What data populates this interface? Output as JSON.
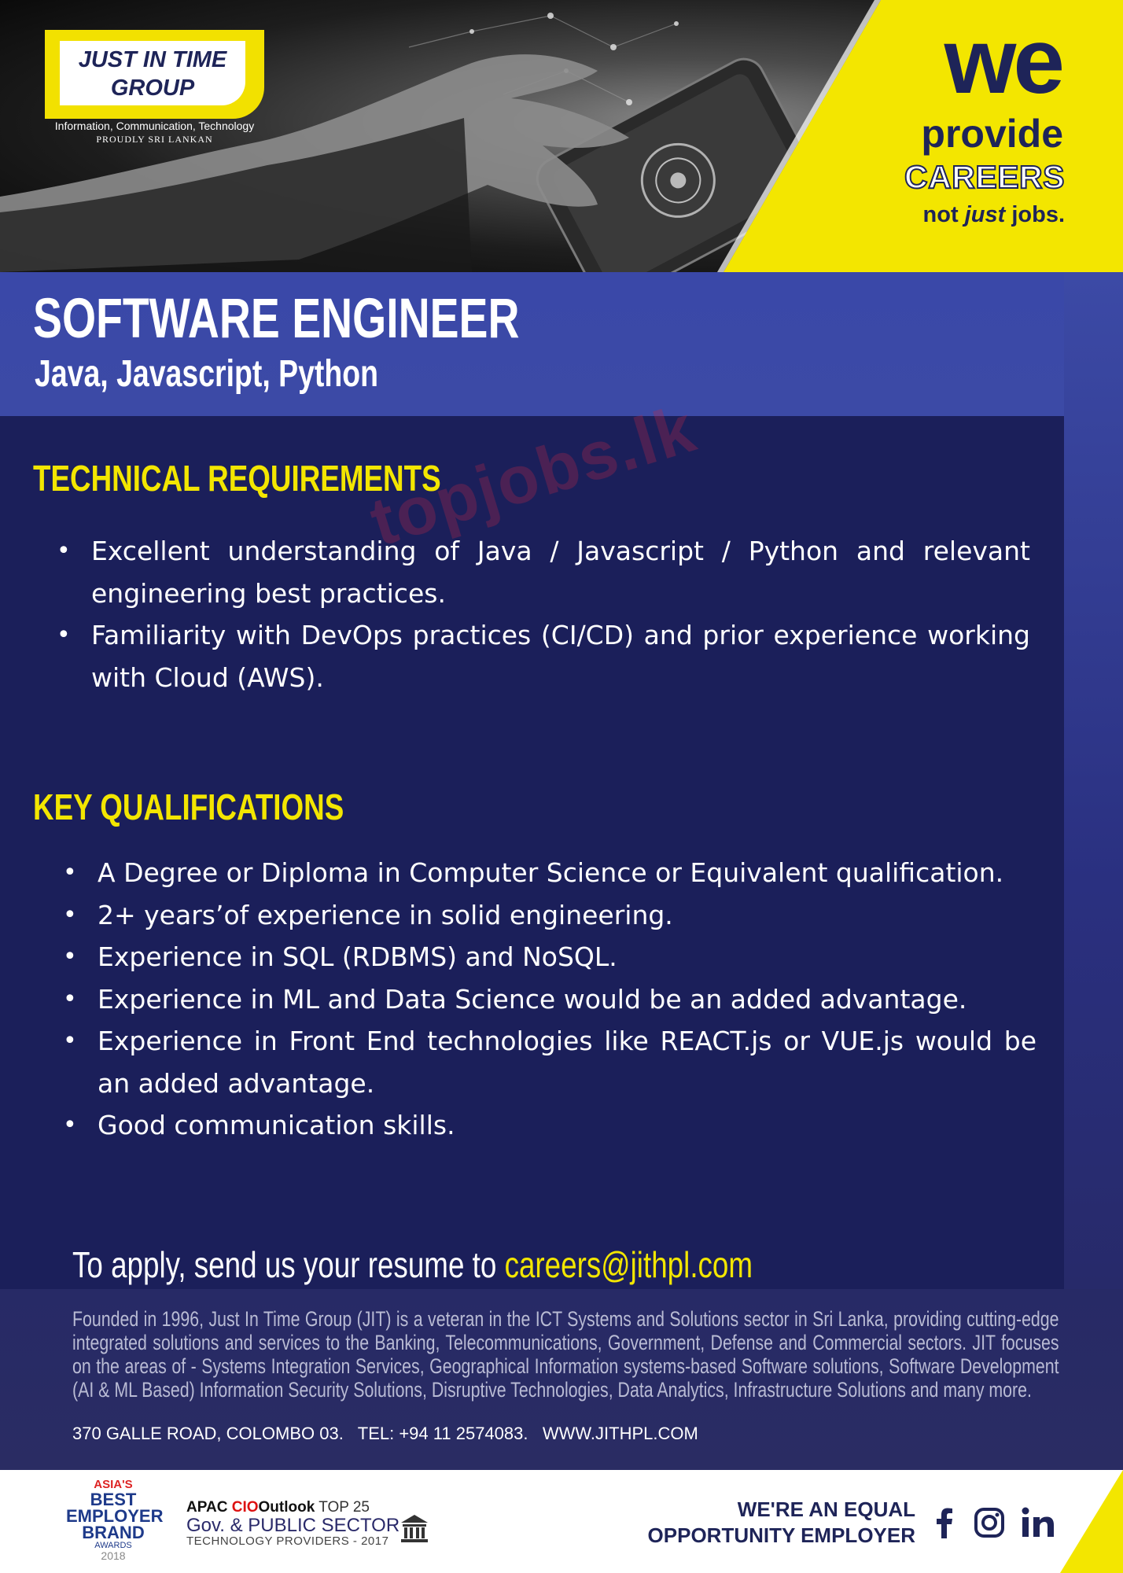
{
  "brand": {
    "logo_line1": "JUST IN TIME",
    "logo_line2": "GROUP",
    "tagline": "Information, Communication, Technology",
    "subtag": "PROUDLY SRI LANKAN",
    "logo_colors": {
      "yellow": "#f2e100",
      "navy": "#1e2458"
    }
  },
  "slogan": {
    "we": "we",
    "provide": "provide",
    "careers": "CAREERS",
    "not": "not",
    "just": "just",
    "jobs": "jobs."
  },
  "job": {
    "title": "SOFTWARE ENGINEER",
    "subtitle": "Java, Javascript, Python"
  },
  "technical": {
    "heading": "TECHNICAL REQUIREMENTS",
    "items": [
      "Excellent understanding of Java / Javascript / Python and relevant engineering best practices.",
      "Familiarity with DevOps practices (CI/CD) and prior experience working with Cloud (AWS)."
    ]
  },
  "key": {
    "heading": "KEY QUALIFICATIONS",
    "items": [
      "A Degree or Diploma in Computer Science or Equivalent qualification.",
      "2+ years’of experience in solid engineering.",
      "Experience in SQL (RDBMS) and NoSQL.",
      "Experience in ML and Data Science would be an added advantage.",
      "Experience in Front End technologies like REACT.js or VUE.js would be an added advantage.",
      "Good communication skills."
    ]
  },
  "watermark": "topjobs.lk",
  "apply": {
    "text": "To apply, send us your resume to ",
    "email": "careers@jithpl.com"
  },
  "about": "Founded in 1996, Just In Time Group (JIT) is a veteran in the ICT Systems and Solutions sector in Sri Lanka, providing cutting-edge integrated solutions and services to the Banking, Telecommunications, Government, Defense and Commercial sectors. JIT focuses on the areas of - Systems Integration Services, Geographical Information systems-based Software solutions, Software Development (AI & ML Based) Information Security Solutions, Disruptive Technologies, Data Analytics, Infrastructure Solutions and many more.",
  "contact": {
    "address": "370 GALLE ROAD, COLOMBO 03.",
    "tel": "TEL: +94 11 2574083.",
    "web": "WWW.JITHPL.COM"
  },
  "awards": {
    "asia": "ASIA'S",
    "best": "BEST",
    "employer": "EMPLOYER",
    "brand": "BRAND",
    "awards": "AWARDS",
    "year": "2018"
  },
  "cio": {
    "apac": "APAC",
    "cio": "CIO",
    "outlook": "Outlook",
    "top": "TOP 25",
    "gov": "Gov. & PUBLIC SECTOR",
    "tech": "TECHNOLOGY PROVIDERS - 2017"
  },
  "equal": {
    "line1": "WE'RE AN EQUAL",
    "line2": "OPPORTUNITY EMPLOYER"
  },
  "social_icons": [
    "facebook-icon",
    "instagram-icon",
    "linkedin-icon"
  ],
  "colors": {
    "navy": "#1b1f5a",
    "band_blue": "#3c4aa6",
    "accent_yellow": "#f3e600"
  }
}
